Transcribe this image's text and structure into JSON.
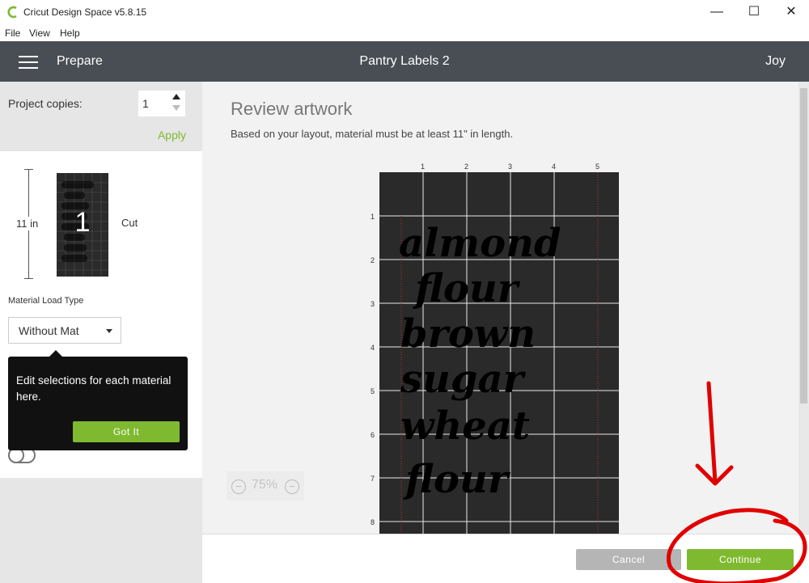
{
  "window": {
    "title": "Cricut Design Space  v5.8.15",
    "controls": {
      "minimize": "—",
      "maximize": "☐",
      "close": "✕"
    }
  },
  "menu": {
    "items": [
      "File",
      "View",
      "Help"
    ]
  },
  "header": {
    "section": "Prepare",
    "project_name": "Pantry Labels 2",
    "user": "Joy"
  },
  "left_panel": {
    "copies_label": "Project copies:",
    "copies_value": "1",
    "apply_label": "Apply",
    "mat_length": "11 in",
    "mat_number": "1",
    "mat_action": "Cut",
    "load_type_label": "Material Load Type",
    "load_type_value": "Without Mat",
    "tooltip_text": "Edit selections for each material here.",
    "tooltip_button": "Got It"
  },
  "main": {
    "title": "Review artwork",
    "note": "Based on your layout, material must be at least 11\" in length.",
    "ruler_x": [
      "1",
      "2",
      "3",
      "4",
      "5"
    ],
    "ruler_y": [
      "1",
      "2",
      "3",
      "4",
      "5",
      "6",
      "7",
      "8"
    ],
    "artwork_lines": [
      "almond",
      "flour",
      "brown",
      "sugar",
      "wheat",
      "flour"
    ],
    "zoom_minus": "−",
    "zoom_plus": "−",
    "zoom_level": "75%"
  },
  "footer": {
    "cancel_label": "Cancel",
    "continue_label": "Continue"
  },
  "colors": {
    "accent_green": "#7fb92f",
    "header_bg": "#494e54",
    "mat_bg": "#2a2a2a",
    "annotation_red": "#e00000"
  }
}
